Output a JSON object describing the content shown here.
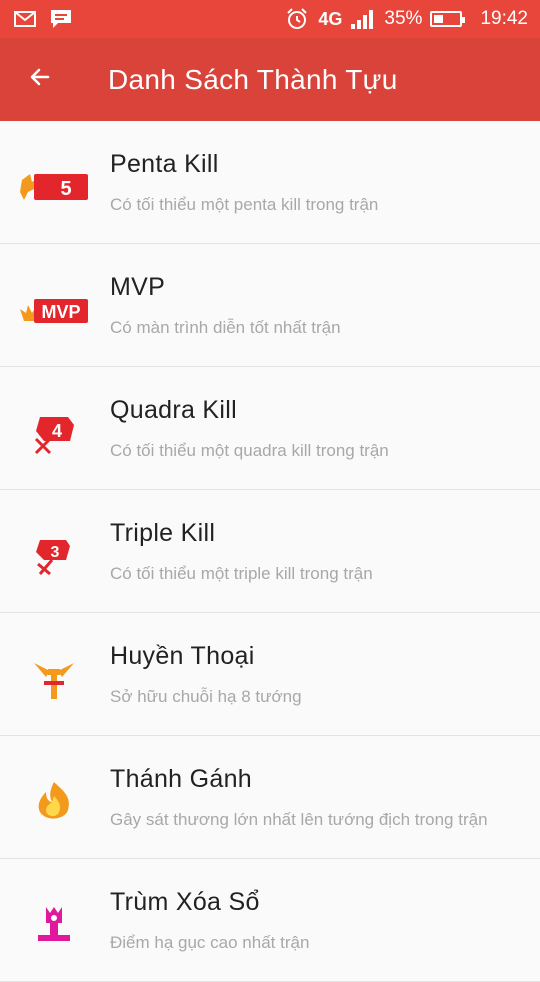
{
  "status_bar": {
    "network": "4G",
    "battery": "35%",
    "battery_level": 0.35,
    "time": "19:42",
    "icons": [
      "mail-icon",
      "chat-icon",
      "alarm-icon",
      "signal-icon",
      "battery-icon"
    ]
  },
  "app_bar": {
    "title": "Danh Sách Thành Tựu",
    "back_icon": "arrow-left-icon"
  },
  "achievements": [
    {
      "title": "Penta Kill",
      "description": "Có tối thiểu một penta kill trong trận",
      "badge_icon": "penta-kill-badge-icon",
      "badge_text": "5"
    },
    {
      "title": "MVP",
      "description": "Có màn trình diễn tốt nhất trận",
      "badge_icon": "mvp-badge-icon",
      "badge_text": "MVP"
    },
    {
      "title": "Quadra Kill",
      "description": "Có tối thiểu một quadra kill trong trận",
      "badge_icon": "quadra-kill-badge-icon",
      "badge_text": "4"
    },
    {
      "title": "Triple Kill",
      "description": "Có tối thiểu một triple kill trong trận",
      "badge_icon": "triple-kill-badge-icon",
      "badge_text": "3"
    },
    {
      "title": "Huyền Thoại",
      "description": "Sở hữu chuỗi hạ 8 tướng",
      "badge_icon": "legendary-badge-icon"
    },
    {
      "title": "Thánh Gánh",
      "description": "Gây sát thương lớn nhất lên tướng địch trong trận",
      "badge_icon": "fire-badge-icon"
    },
    {
      "title": "Trùm Xóa Sổ",
      "description": "Điểm hạ gục cao nhất trận",
      "badge_icon": "crown-badge-icon"
    }
  ],
  "colors": {
    "status_bar": "#e8463b",
    "app_bar": "#d9433a",
    "badge_red": "#e3262b",
    "badge_orange": "#f39a1d"
  }
}
